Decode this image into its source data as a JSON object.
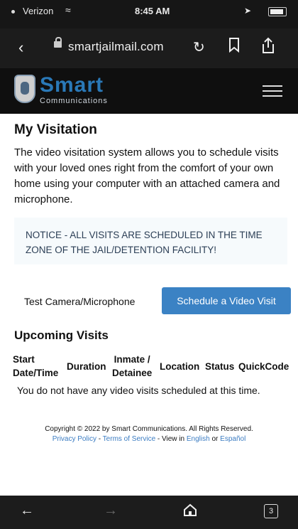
{
  "status_bar": {
    "carrier": "Verizon",
    "time": "8:45 AM"
  },
  "browser": {
    "url": "smartjailmail.com",
    "tab_count": "3"
  },
  "site": {
    "logo_name": "Smart",
    "logo_subtitle": "Communications"
  },
  "page": {
    "title": "My Visitation",
    "intro": "The video visitation system allows you to schedule visits with your loved ones right from the comfort of your own home using your computer with an attached camera and microphone.",
    "notice": "NOTICE - ALL VISITS ARE SCHEDULED IN THE TIME ZONE OF THE JAIL/DETENTION FACILITY!",
    "test_camera_label": "Test Camera/Microphone",
    "schedule_button_label": "Schedule a Video Visit",
    "upcoming_heading": "Upcoming Visits",
    "table_headers": {
      "start_line1": "Start",
      "start_line2": "Date/Time",
      "duration": "Duration",
      "inmate_line1": "Inmate /",
      "inmate_line2": "Detainee",
      "location": "Location",
      "status": "Status",
      "quick_code": "QuickCode"
    },
    "empty_message": "You do not have any video visits scheduled at this time."
  },
  "footer": {
    "copyright": "Copyright © 2022 by Smart Communications. All Rights Reserved.",
    "privacy": "Privacy Policy",
    "terms": "Terms of Service",
    "view_in": "View in",
    "english": "English",
    "or": "or",
    "espanol": "Español"
  },
  "colors": {
    "brand_blue": "#2a79b8",
    "button_blue": "#3b82c4",
    "link_blue": "#3b7cc2"
  },
  "icons": [
    "back-icon",
    "lock-icon",
    "reload-icon",
    "bookmark-icon",
    "share-icon",
    "menu-icon",
    "forward-icon",
    "home-icon",
    "tabs-icon"
  ]
}
